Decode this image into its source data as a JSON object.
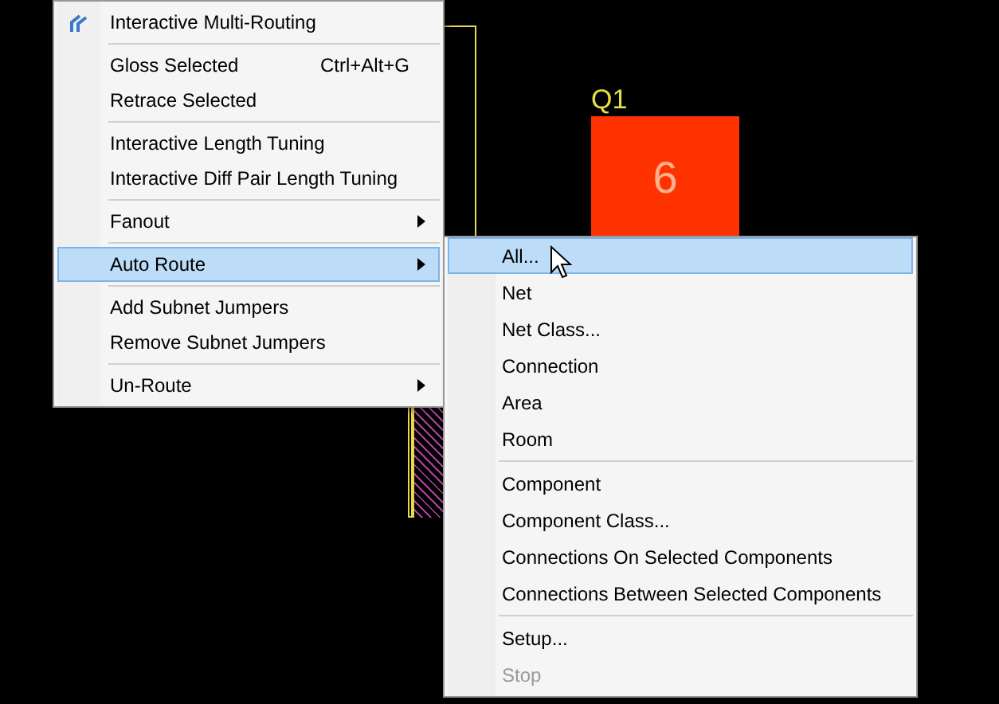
{
  "canvas": {
    "designator": "Q1",
    "pad_number": "6"
  },
  "context_menu": {
    "items": [
      {
        "kind": "item",
        "label": "Interactive Multi-Routing",
        "icon": true,
        "has_submenu": false,
        "selected": false
      },
      {
        "kind": "separator"
      },
      {
        "kind": "item",
        "label": "Gloss Selected",
        "shortcut": "Ctrl+Alt+G",
        "has_submenu": false,
        "selected": false
      },
      {
        "kind": "item",
        "label": "Retrace Selected",
        "has_submenu": false,
        "selected": false
      },
      {
        "kind": "separator"
      },
      {
        "kind": "item",
        "label": "Interactive Length Tuning",
        "has_submenu": false,
        "selected": false
      },
      {
        "kind": "item",
        "label": "Interactive Diff Pair Length Tuning",
        "has_submenu": false,
        "selected": false
      },
      {
        "kind": "separator"
      },
      {
        "kind": "item",
        "label": "Fanout",
        "has_submenu": true,
        "selected": false
      },
      {
        "kind": "separator"
      },
      {
        "kind": "item",
        "label": "Auto Route",
        "has_submenu": true,
        "selected": true
      },
      {
        "kind": "separator"
      },
      {
        "kind": "item",
        "label": "Add Subnet Jumpers",
        "has_submenu": false,
        "selected": false
      },
      {
        "kind": "item",
        "label": "Remove Subnet Jumpers",
        "has_submenu": false,
        "selected": false
      },
      {
        "kind": "separator"
      },
      {
        "kind": "item",
        "label": "Un-Route",
        "has_submenu": true,
        "selected": false
      }
    ]
  },
  "submenu": {
    "items": [
      {
        "kind": "item",
        "label": "All...",
        "selected": true,
        "disabled": false
      },
      {
        "kind": "item",
        "label": "Net",
        "selected": false,
        "disabled": false
      },
      {
        "kind": "item",
        "label": "Net Class...",
        "selected": false,
        "disabled": false
      },
      {
        "kind": "item",
        "label": "Connection",
        "selected": false,
        "disabled": false
      },
      {
        "kind": "item",
        "label": "Area",
        "selected": false,
        "disabled": false
      },
      {
        "kind": "item",
        "label": "Room",
        "selected": false,
        "disabled": false
      },
      {
        "kind": "separator"
      },
      {
        "kind": "item",
        "label": "Component",
        "selected": false,
        "disabled": false
      },
      {
        "kind": "item",
        "label": "Component Class...",
        "selected": false,
        "disabled": false
      },
      {
        "kind": "item",
        "label": "Connections On Selected Components",
        "selected": false,
        "disabled": false
      },
      {
        "kind": "item",
        "label": "Connections Between Selected Components",
        "selected": false,
        "disabled": false
      },
      {
        "kind": "separator"
      },
      {
        "kind": "item",
        "label": "Setup...",
        "selected": false,
        "disabled": false
      },
      {
        "kind": "item",
        "label": "Stop",
        "selected": false,
        "disabled": true
      }
    ]
  }
}
